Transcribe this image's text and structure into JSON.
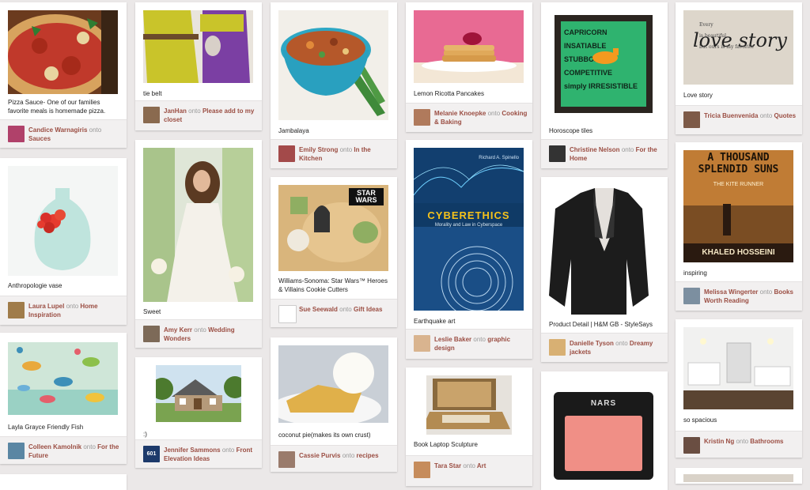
{
  "pins": [
    {
      "id": "pizza",
      "desc": "Pizza Sauce- One of our families favorite meals is homemade pizza.",
      "user": "Candice Warnagiris",
      "onto": "onto",
      "board": "Sauces"
    },
    {
      "id": "belt",
      "desc": "tie belt",
      "user": "JanHan",
      "onto": "onto",
      "board": "Please add to my closet"
    },
    {
      "id": "jambalaya",
      "desc": "Jambalaya",
      "user": "Emily Strong",
      "onto": "onto",
      "board": "In the Kitchen"
    },
    {
      "id": "pancakes",
      "desc": "Lemon Ricotta Pancakes",
      "user": "Melanie Knoepke",
      "onto": "onto",
      "board": "Cooking & Baking"
    },
    {
      "id": "horoscope",
      "desc": "Horoscope tiles",
      "user": "Christine Nelson",
      "onto": "onto",
      "board": "For the Home"
    },
    {
      "id": "lovestory",
      "desc": "Love story",
      "user": "Tricia Buenvenida",
      "onto": "onto",
      "board": "Quotes"
    },
    {
      "id": "vase",
      "desc": "Anthropologie vase",
      "user": "Laura Lupel",
      "onto": "onto",
      "board": "Home Inspiration"
    },
    {
      "id": "sweet",
      "desc": "Sweet",
      "user": "Amy Kerr",
      "onto": "onto",
      "board": "Wedding Wonders"
    },
    {
      "id": "starwars",
      "desc": "Williams-Sonoma: Star Wars™ Heroes & Villains Cookie Cutters",
      "user": "Sue Seewald",
      "onto": "onto",
      "board": "Gift Ideas"
    },
    {
      "id": "cyberethics",
      "desc": "Earthquake art",
      "user": "Leslie Baker",
      "onto": "onto",
      "board": "graphic design"
    },
    {
      "id": "jacket",
      "desc": "Product Detail | H&M GB - StyleSays",
      "user": "Danielle Tyson",
      "onto": "onto",
      "board": "Dreamy jackets"
    },
    {
      "id": "kiterunner",
      "desc": "inspiring",
      "user": "Melissa Wingerter",
      "onto": "onto",
      "board": "Books Worth Reading"
    },
    {
      "id": "fish",
      "desc": "Layla Grayce Friendly Fish",
      "user": "Colleen Kamolnik",
      "onto": "onto",
      "board": "For the Future"
    },
    {
      "id": "house",
      "desc": ":)",
      "user": "Jennifer Sammons",
      "onto": "onto",
      "board": "Front Elevation Ideas"
    },
    {
      "id": "coconut",
      "desc": "coconut pie(makes its own crust)",
      "user": "Cassie Purvis",
      "onto": "onto",
      "board": "recipes"
    },
    {
      "id": "laptop",
      "desc": "Book Laptop Sculpture",
      "user": "Tara Star",
      "onto": "onto",
      "board": "Art"
    },
    {
      "id": "nars",
      "desc": "",
      "user": "",
      "onto": "",
      "board": ""
    },
    {
      "id": "bathroom",
      "desc": "so spacious",
      "user": "Kristin Ng",
      "onto": "onto",
      "board": "Bathrooms"
    }
  ],
  "image_text": {
    "horoscope": "CAPRICORN\nINSATIABLE\nSTUBBORN\nCOMPETITIVE\nsimply IRRESISTIBLE",
    "lovestory_big": "love story",
    "lovestory_small": "Every\nis beautiful,\nbut ours is my favorite",
    "starwars_logo": "STAR\nWARS",
    "cyber_author": "Richard A. Spinello",
    "cyber_title": "CYBERETHICS",
    "cyber_sub": "Morality and Law in Cyberspace",
    "kite_top": "A THOUSAND\nSPLENDID SUNS",
    "kite_mid": "THE KITE RUNNER",
    "kite_author": "KHALED HOSSEINI",
    "nars_logo": "NARS",
    "avatar_601": "601"
  },
  "colors": {
    "background": "#ebe8e8",
    "link": "#9b4e43",
    "muted": "#999999",
    "footer": "#f2f0f0"
  }
}
